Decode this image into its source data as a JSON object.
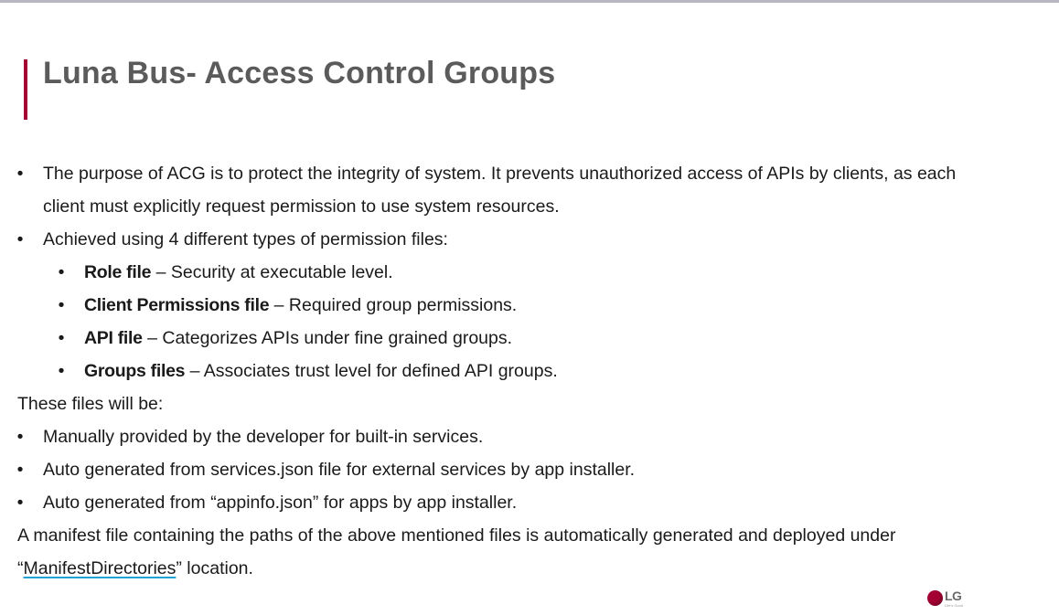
{
  "slide": {
    "title": "Luna Bus- Access Control Groups",
    "bullet_char": "•",
    "purpose_line1": "The purpose of ACG is to protect the integrity of system. It prevents unauthorized access of APIs by clients, as each",
    "purpose_line2": "client must explicitly request permission to use system resources.",
    "achieved": "Achieved using 4 different types of permission files:",
    "permission_files": [
      {
        "name": "Role file",
        "desc": " – Security at executable level."
      },
      {
        "name": "Client Permissions file",
        "desc": " – Required group permissions."
      },
      {
        "name": "API file",
        "desc": " – Categorizes APIs under fine grained groups."
      },
      {
        "name": "Groups files",
        "desc": " – Associates trust level for defined API groups."
      }
    ],
    "these_files": "These files will be:",
    "sources": [
      "Manually provided by the developer for built-in services.",
      "Auto generated from services.json file for external services by app installer.",
      "Auto generated from “appinfo.json” for apps by app installer."
    ],
    "manifest_line1": "A manifest file containing the paths of the above mentioned files is automatically generated and deployed under",
    "manifest_open_quote": "“",
    "manifest_link": "ManifestDirectories",
    "manifest_close": "” location."
  },
  "logo": {
    "text": "LG",
    "tagline": "Life's Good",
    "color": "#a50034"
  },
  "colors": {
    "accent": "#a50034",
    "title": "#5b5b5b",
    "body_text": "#1a1a1a",
    "link_underline": "#20a4d6"
  }
}
